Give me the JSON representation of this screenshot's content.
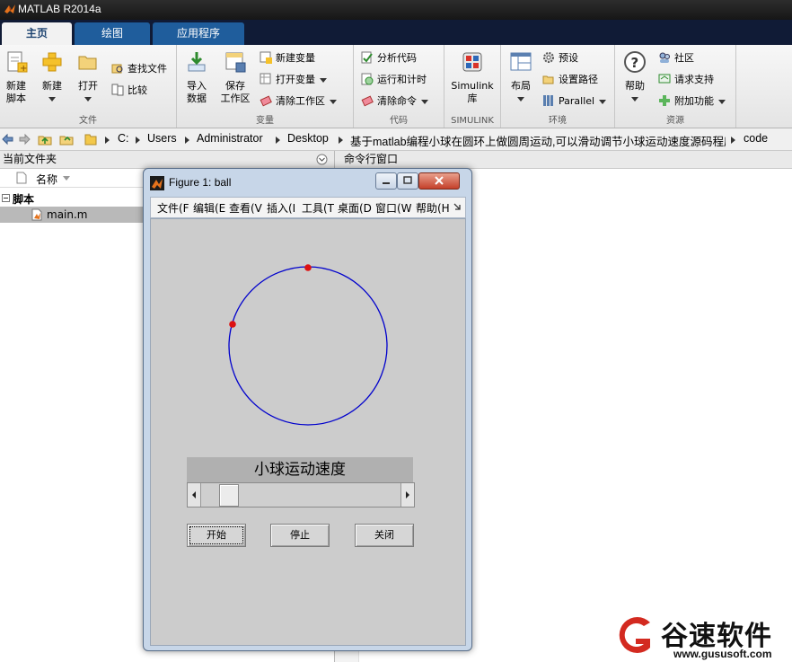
{
  "window": {
    "title": "MATLAB R2014a"
  },
  "tabs": [
    {
      "label": "主页"
    },
    {
      "label": "绘图"
    },
    {
      "label": "应用程序"
    }
  ],
  "ribbon": {
    "file": {
      "group_label": "文件",
      "new_script": "新建\n脚本",
      "new": "新建",
      "open": "打开",
      "find_files": "查找文件",
      "compare": "比较"
    },
    "variable": {
      "group_label": "变量",
      "import": "导入\n数据",
      "save_ws": "保存\n工作区",
      "new_var": "新建变量",
      "open_var": "打开变量",
      "clear_ws": "清除工作区"
    },
    "code": {
      "group_label": "代码",
      "analyze": "分析代码",
      "run_time": "运行和计时",
      "clear_cmd": "清除命令"
    },
    "simulink": {
      "group_label": "SIMULINK",
      "lib": "Simulink\n库"
    },
    "env": {
      "group_label": "环境",
      "layout": "布局",
      "prefs": "预设",
      "set_path": "设置路径",
      "parallel": "Parallel"
    },
    "resources": {
      "group_label": "资源",
      "help": "帮助",
      "community": "社区",
      "support": "请求支持",
      "addons": "附加功能"
    }
  },
  "address": {
    "crumbs": [
      "C:",
      "Users",
      "Administrator",
      "Desktop",
      "基于matlab编程小球在圆环上做圆周运动,可以滑动调节小球运动速度源码程序",
      "code"
    ]
  },
  "current_folder": {
    "title": "当前文件夹",
    "column": "名称",
    "group": "脚本",
    "files": [
      "main.m"
    ]
  },
  "command_window": {
    "title": "命令行窗口"
  },
  "figure": {
    "title": "Figure 1: ball",
    "menu": [
      "文件(F",
      "编辑(E",
      "查看(V",
      "插入(I",
      "工具(T",
      "桌面(D",
      "窗口(W",
      "帮助(H"
    ],
    "speed_label": "小球运动速度",
    "slider_value": 0.1,
    "buttons": {
      "start": "开始",
      "stop": "停止",
      "close": "关闭"
    }
  },
  "watermark": {
    "name": "谷速软件",
    "url": "www.gususoft.com"
  },
  "colors": {
    "circle": "#0000cc",
    "ball": "#dd1111",
    "fig_bg": "#cccccc"
  }
}
